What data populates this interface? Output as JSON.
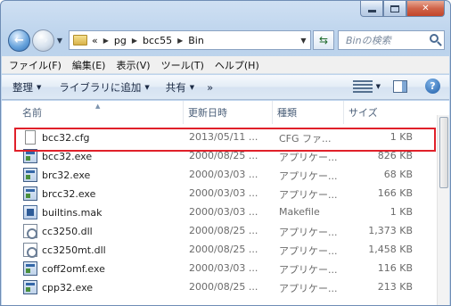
{
  "window": {
    "caption": {
      "minimize": "",
      "maximize": "",
      "close": "✕"
    }
  },
  "nav": {
    "back": "←",
    "forward": "→",
    "breadcrumbs": [
      "pg",
      "bcc55",
      "Bin"
    ],
    "breadcrumb_overflow": "«",
    "search_placeholder": "Binの検索"
  },
  "menu": [
    "ファイル(F)",
    "編集(E)",
    "表示(V)",
    "ツール(T)",
    "ヘルプ(H)"
  ],
  "toolbar": {
    "organize": "整理",
    "add_to_library": "ライブラリに追加",
    "share": "共有",
    "more": "»"
  },
  "columns": {
    "name": "名前",
    "date": "更新日時",
    "type": "種類",
    "size": "サイズ"
  },
  "files": [
    {
      "name": "bcc32.cfg",
      "date": "2013/05/11 ...",
      "type": "CFG ファ...",
      "size": "1 KB",
      "icon": "doc"
    },
    {
      "name": "bcc32.exe",
      "date": "2000/08/25 ...",
      "type": "アプリケー...",
      "size": "826 KB",
      "icon": "exe"
    },
    {
      "name": "brc32.exe",
      "date": "2000/03/03 ...",
      "type": "アプリケー...",
      "size": "68 KB",
      "icon": "exe"
    },
    {
      "name": "brcc32.exe",
      "date": "2000/03/03 ...",
      "type": "アプリケー...",
      "size": "166 KB",
      "icon": "exe"
    },
    {
      "name": "builtins.mak",
      "date": "2000/03/03 ...",
      "type": "Makefile",
      "size": "1 KB",
      "icon": "mak"
    },
    {
      "name": "cc3250.dll",
      "date": "2000/08/25 ...",
      "type": "アプリケー...",
      "size": "1,373 KB",
      "icon": "dll"
    },
    {
      "name": "cc3250mt.dll",
      "date": "2000/08/25 ...",
      "type": "アプリケー...",
      "size": "1,458 KB",
      "icon": "dll"
    },
    {
      "name": "coff2omf.exe",
      "date": "2000/03/03 ...",
      "type": "アプリケー...",
      "size": "116 KB",
      "icon": "exe"
    },
    {
      "name": "cpp32.exe",
      "date": "2000/08/25 ...",
      "type": "アプリケー...",
      "size": "213 KB",
      "icon": "exe"
    }
  ],
  "highlight_color": "#e0202a"
}
